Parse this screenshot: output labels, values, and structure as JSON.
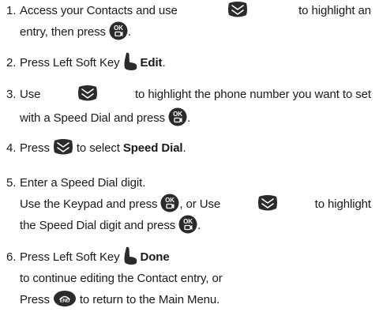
{
  "steps": [
    {
      "number": "1.",
      "line1": {
        "part_a": "Access your Contacts and use",
        "part_b": "to highlight an"
      },
      "line2": {
        "part_a": "entry, then press",
        "part_b": "."
      }
    },
    {
      "number": "2.",
      "text": "Press Left Soft Key",
      "bold": "Edit",
      "end": "."
    },
    {
      "number": "3.",
      "line1": {
        "part_a": "Use",
        "part_b": "to highlight the phone number you want to set"
      },
      "line2": {
        "part_a": "with a Speed Dial and press",
        "part_b": "."
      }
    },
    {
      "number": "4.",
      "part_a": "Press",
      "part_b": "to select",
      "bold": "Speed Dial",
      "end": "."
    },
    {
      "number": "5.",
      "line1": "Enter a Speed Dial digit.",
      "line2": {
        "part_a": "Use the Keypad and press",
        "part_b": ", or Use",
        "part_c": "to highlight"
      },
      "line3": {
        "part_a": "the Speed Dial digit and press",
        "part_b": "."
      }
    },
    {
      "number": "6.",
      "line1": {
        "part_a": "Press Left Soft Key",
        "bold": "Done"
      },
      "line2": "to continue editing the Contact entry, or",
      "line3": {
        "part_a": "Press",
        "part_b": "to return to the Main Menu."
      }
    }
  ],
  "icons": {
    "nav_key": "navigation-key-icon",
    "ok_key": "ok-key-icon",
    "left_soft_key": "left-soft-key-icon",
    "end_key": "end-key-icon",
    "ok_glyph": "OK",
    "end_glyph": "END"
  }
}
